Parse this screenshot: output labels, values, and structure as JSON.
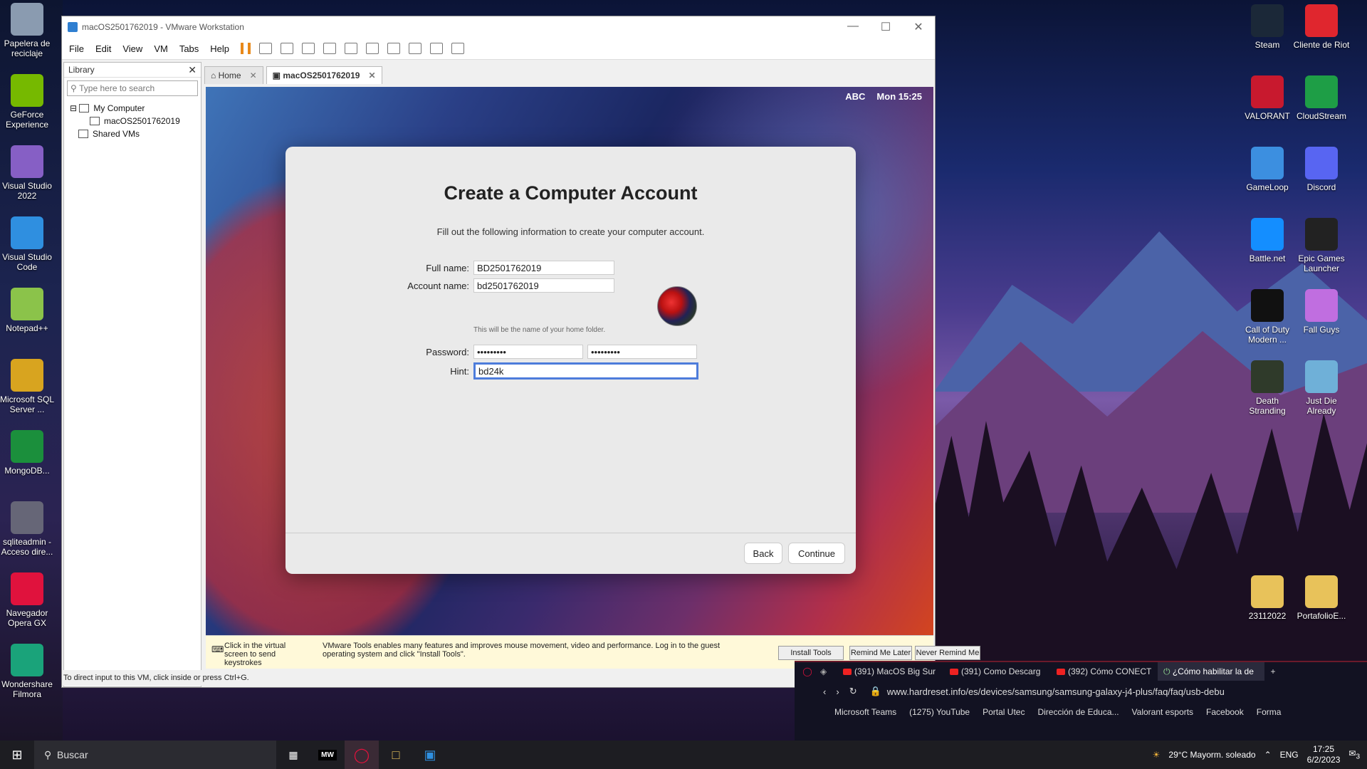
{
  "desktop": {
    "left_icons": [
      {
        "label": "Papelera de reciclaje",
        "color": "#8a9bb0"
      },
      {
        "label": "GeForce Experience",
        "color": "#76b900"
      },
      {
        "label": "Visual Studio 2022",
        "color": "#865fc5"
      },
      {
        "label": "Visual Studio Code",
        "color": "#2f8fe0"
      },
      {
        "label": "Notepad++",
        "color": "#8bc34a"
      },
      {
        "label": "Microsoft SQL Server ...",
        "color": "#d8a41f"
      },
      {
        "label": "MongoDB...",
        "color": "#1b8f3c"
      },
      {
        "label": "sqliteadmin - Acceso dire...",
        "color": "#667"
      },
      {
        "label": "Navegador Opera GX",
        "color": "#e0123d"
      },
      {
        "label": "Wondershare Filmora",
        "color": "#1aa37a"
      }
    ],
    "right_icons": [
      {
        "label": "Steam",
        "color": "#1b2838"
      },
      {
        "label": "Cliente de Riot",
        "color": "#e0262e"
      },
      {
        "label": "VALORANT",
        "color": "#c8192e"
      },
      {
        "label": "CloudStream",
        "color": "#1e9e46"
      },
      {
        "label": "GameLoop",
        "color": "#3c8fe0"
      },
      {
        "label": "Discord",
        "color": "#5865f2"
      },
      {
        "label": "Battle.net",
        "color": "#148eff"
      },
      {
        "label": "Epic Games Launcher",
        "color": "#222"
      },
      {
        "label": "Call of Duty Modern ...",
        "color": "#111"
      },
      {
        "label": "Fall Guys",
        "color": "#c06ee0"
      },
      {
        "label": "Death Stranding",
        "color": "#2f3a2a"
      },
      {
        "label": "Just Die Already",
        "color": "#6fb0d8"
      },
      {
        "label": "23112022",
        "color": "#e8c25a"
      },
      {
        "label": "PortafolioE...",
        "color": "#e8c25a"
      }
    ]
  },
  "vmware": {
    "title": "macOS2501762019 - VMware Workstation",
    "menu": [
      "File",
      "Edit",
      "View",
      "VM",
      "Tabs",
      "Help"
    ],
    "library": {
      "title": "Library",
      "search_placeholder": "Type here to search",
      "my_computer": "My Computer",
      "vm_name": "macOS2501762019",
      "shared": "Shared VMs"
    },
    "tabs": [
      {
        "label": "Home"
      },
      {
        "label": "macOS2501762019"
      }
    ],
    "notify": {
      "click_hint": "Click in the virtual screen to send keystrokes",
      "message": "VMware Tools enables many features and improves mouse movement, video and performance. Log in to the guest operating system and click \"Install Tools\".",
      "install": "Install Tools",
      "remind": "Remind Me Later",
      "never": "Never Remind Me"
    },
    "status": "To direct input to this VM, click inside or press Ctrl+G."
  },
  "mac": {
    "input_source": "ABC",
    "clock": "Mon 15:25",
    "title": "Create a Computer Account",
    "subtitle": "Fill out the following information to create your computer account.",
    "full_name_label": "Full name:",
    "full_name": "BD2501762019",
    "account_label": "Account name:",
    "account_name": "bd2501762019",
    "account_note": "This will be the name of your home folder.",
    "password_label": "Password:",
    "password": "•••••••••",
    "verify": "•••••••••",
    "hint_label": "Hint:",
    "hint": "bd24k",
    "back": "Back",
    "continue": "Continue"
  },
  "browser": {
    "tabs": [
      "(391) MacOS Big Sur",
      "(391) Como Descarg",
      "(392) Cómo CONECT",
      "¿Cómo habilitar la de"
    ],
    "url": "www.hardreset.info/es/devices/samsung/samsung-galaxy-j4-plus/faq/faq/usb-debu",
    "bookmarks": [
      "Microsoft Teams",
      "(1275) YouTube",
      "Portal Utec",
      "Dirección de Educa...",
      "Valorant esports",
      "Facebook",
      "Forma"
    ]
  },
  "taskbar": {
    "search_placeholder": "Buscar",
    "weather": "29°C  Mayorm. soleado",
    "lang": "ENG",
    "time": "17:25",
    "date": "6/2/2023",
    "notif_count": "3"
  }
}
